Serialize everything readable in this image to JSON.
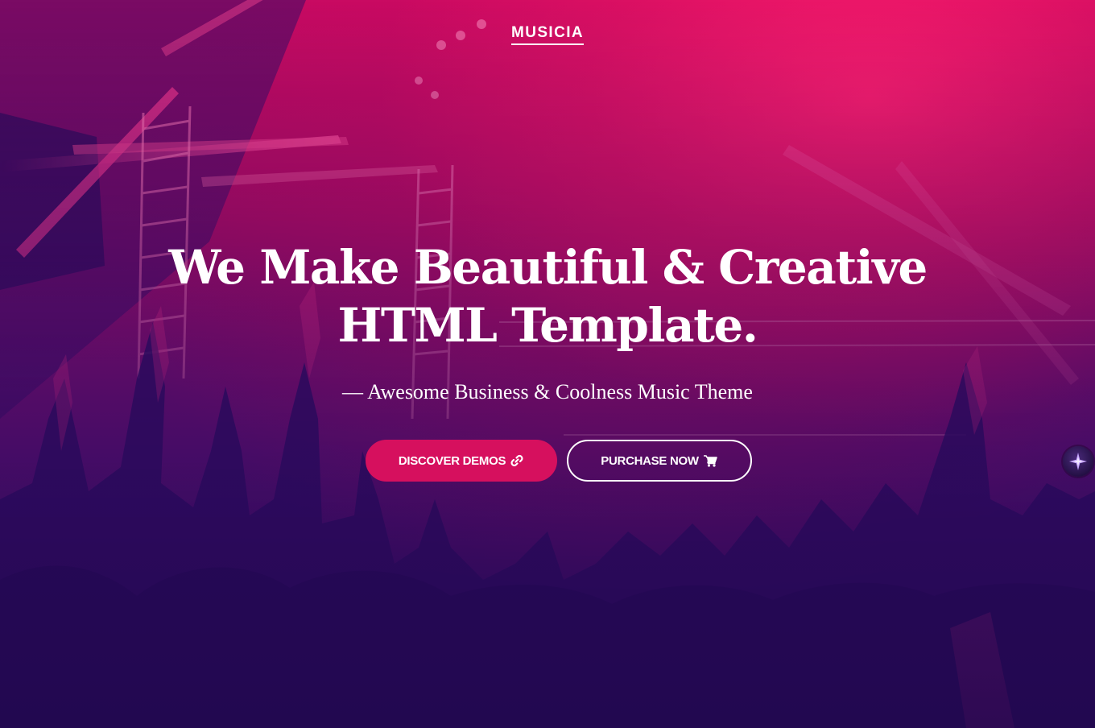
{
  "brand": {
    "name": "MUSICIA"
  },
  "hero": {
    "headline_line1": "We Make Beautiful & Creative",
    "headline_line2": "HTML Template.",
    "subtitle": "— Awesome Business & Coolness Music Theme"
  },
  "actions": {
    "discover_label": "DISCOVER DEMOS",
    "discover_icon": "link-icon",
    "purchase_label": "PURCHASE NOW",
    "purchase_icon": "cart-icon"
  },
  "floating_widget": {
    "icon": "sparkle-icon"
  },
  "colors": {
    "accent": "#d6105e",
    "overlay_pink": "#c80a62",
    "overlay_navy": "#2a0a5c",
    "text": "#ffffff"
  }
}
